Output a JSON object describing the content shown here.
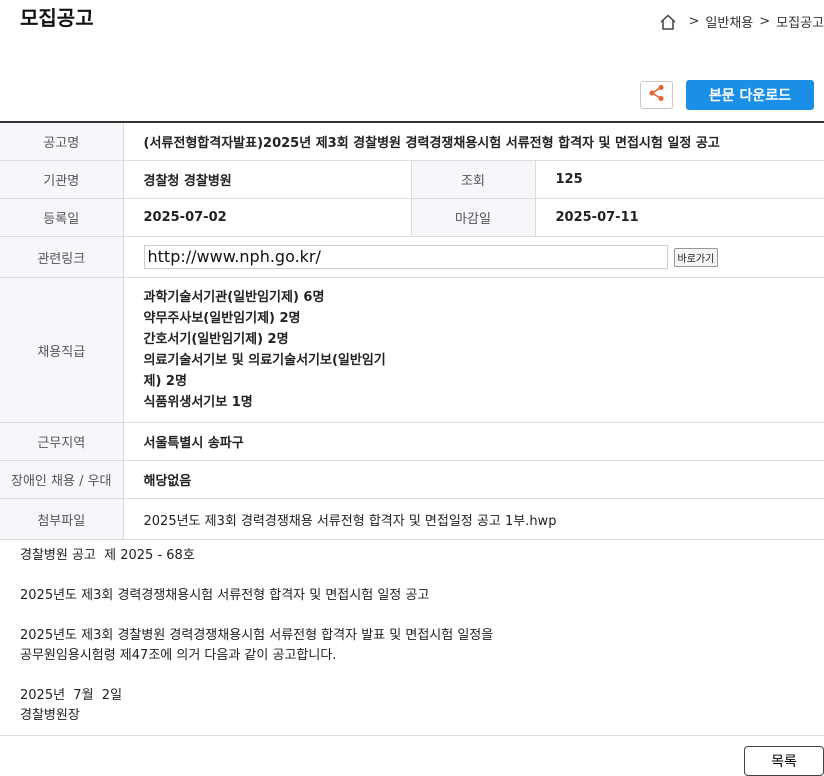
{
  "page": {
    "title": "모집공고"
  },
  "breadcrumb": {
    "items": [
      "일반채용",
      "모집공고"
    ],
    "separator": ">"
  },
  "actions": {
    "download_label": "본문 다운로드"
  },
  "colors": {
    "accent": "#1b8fe6",
    "share_icon": "#e8612c"
  },
  "info": {
    "title_label": "공고명",
    "title_value": "(서류전형합격자발표)2025년 제3회 경찰병원 경력경쟁채용시험 서류전형 합격자 및 면접시험 일정 공고",
    "agency_label": "기관명",
    "agency_value": "경찰청 경찰병원",
    "views_label": "조회",
    "views_value": "125",
    "reg_label": "등록일",
    "reg_value": "2025-07-02",
    "deadline_label": "마감일",
    "deadline_value": "2025-07-11",
    "link_label": "관련링크",
    "link_value": "http://www.nph.go.kr/",
    "go_label": "바로가기",
    "jobs_label": "채용직급",
    "jobs": [
      "과학기술서기관(일반임기제) 6명",
      "약무주사보(일반임기제) 2명",
      "간호서기(일반임기제) 2명",
      "의료기술서기보 및 의료기술서기보(일반임기제) 2명",
      "식품위생서기보 1명"
    ],
    "region_label": "근무지역",
    "region_value": "서울특별시 송파구",
    "disability_label": "장애인 채용 / 우대",
    "disability_value": "해당없음",
    "attach_label": "첨부파일",
    "attach_value": "2025년도 제3회 경력경쟁채용 서류전형 합격자 및 면접일정 공고 1부.hwp"
  },
  "content": {
    "line1": "경찰병원 공고  제 2025 - 68호",
    "line2": "2025년도 제3회 경력경쟁채용시험 서류전형 합격자 및 면접시험 일정 공고",
    "line3": "2025년도 제3회 경찰병원 경력경쟁채용시험 서류전형 합격자 발표 및 면접시험 일정을",
    "line4": "공무원임용시험령 제47조에 의거 다음과 같이 공고합니다.",
    "line5": "2025년  7월  2일",
    "line6": "경찰병원장"
  },
  "footer": {
    "list_label": "목록"
  }
}
